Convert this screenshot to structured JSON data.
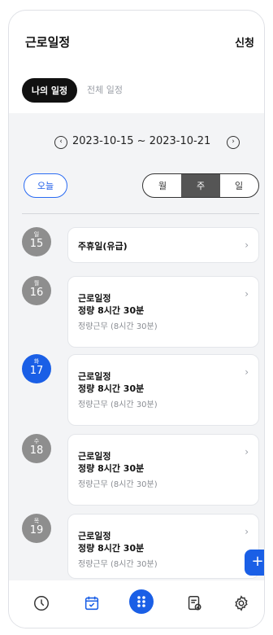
{
  "header": {
    "title": "근로일정",
    "action_label": "신청"
  },
  "tabs": [
    {
      "label": "나의 일정",
      "active": true
    },
    {
      "label": "전체 일정",
      "active": false
    }
  ],
  "range": {
    "prev_label": "‹",
    "text": "2023-10-15 ~ 2023-10-21",
    "next_label": "›"
  },
  "today_label": "오늘",
  "view_toggle": {
    "options": [
      "월",
      "주",
      "일"
    ],
    "selected": "주"
  },
  "days": [
    {
      "dow": "일",
      "date": "15",
      "is_today": false,
      "title": "주휴일(유급)",
      "line2": "",
      "line3": ""
    },
    {
      "dow": "월",
      "date": "16",
      "is_today": false,
      "title": "근로일정",
      "line2": "정량 8시간 30분",
      "line3": "정량근무 (8시간 30분)"
    },
    {
      "dow": "화",
      "date": "17",
      "is_today": true,
      "title": "근로일정",
      "line2": "정량 8시간 30분",
      "line3": "정량근무 (8시간 30분)"
    },
    {
      "dow": "수",
      "date": "18",
      "is_today": false,
      "title": "근로일정",
      "line2": "정량 8시간 30분",
      "line3": "정량근무 (8시간 30분)"
    },
    {
      "dow": "목",
      "date": "19",
      "is_today": false,
      "title": "근로일정",
      "line2": "정량 8시간 30분",
      "line3": "정량근무 (8시간 30분)"
    }
  ],
  "chevron": "›",
  "fab_label": "+",
  "colors": {
    "accent": "#1a5fe6",
    "muted": "#8e8e8e",
    "background": "#f3f4f6"
  },
  "bottom_nav": [
    {
      "icon": "clock-icon"
    },
    {
      "icon": "calendar-check-icon",
      "active": true
    },
    {
      "icon": "dots-grid-icon"
    },
    {
      "icon": "document-check-icon"
    },
    {
      "icon": "settings-gear-icon"
    }
  ]
}
